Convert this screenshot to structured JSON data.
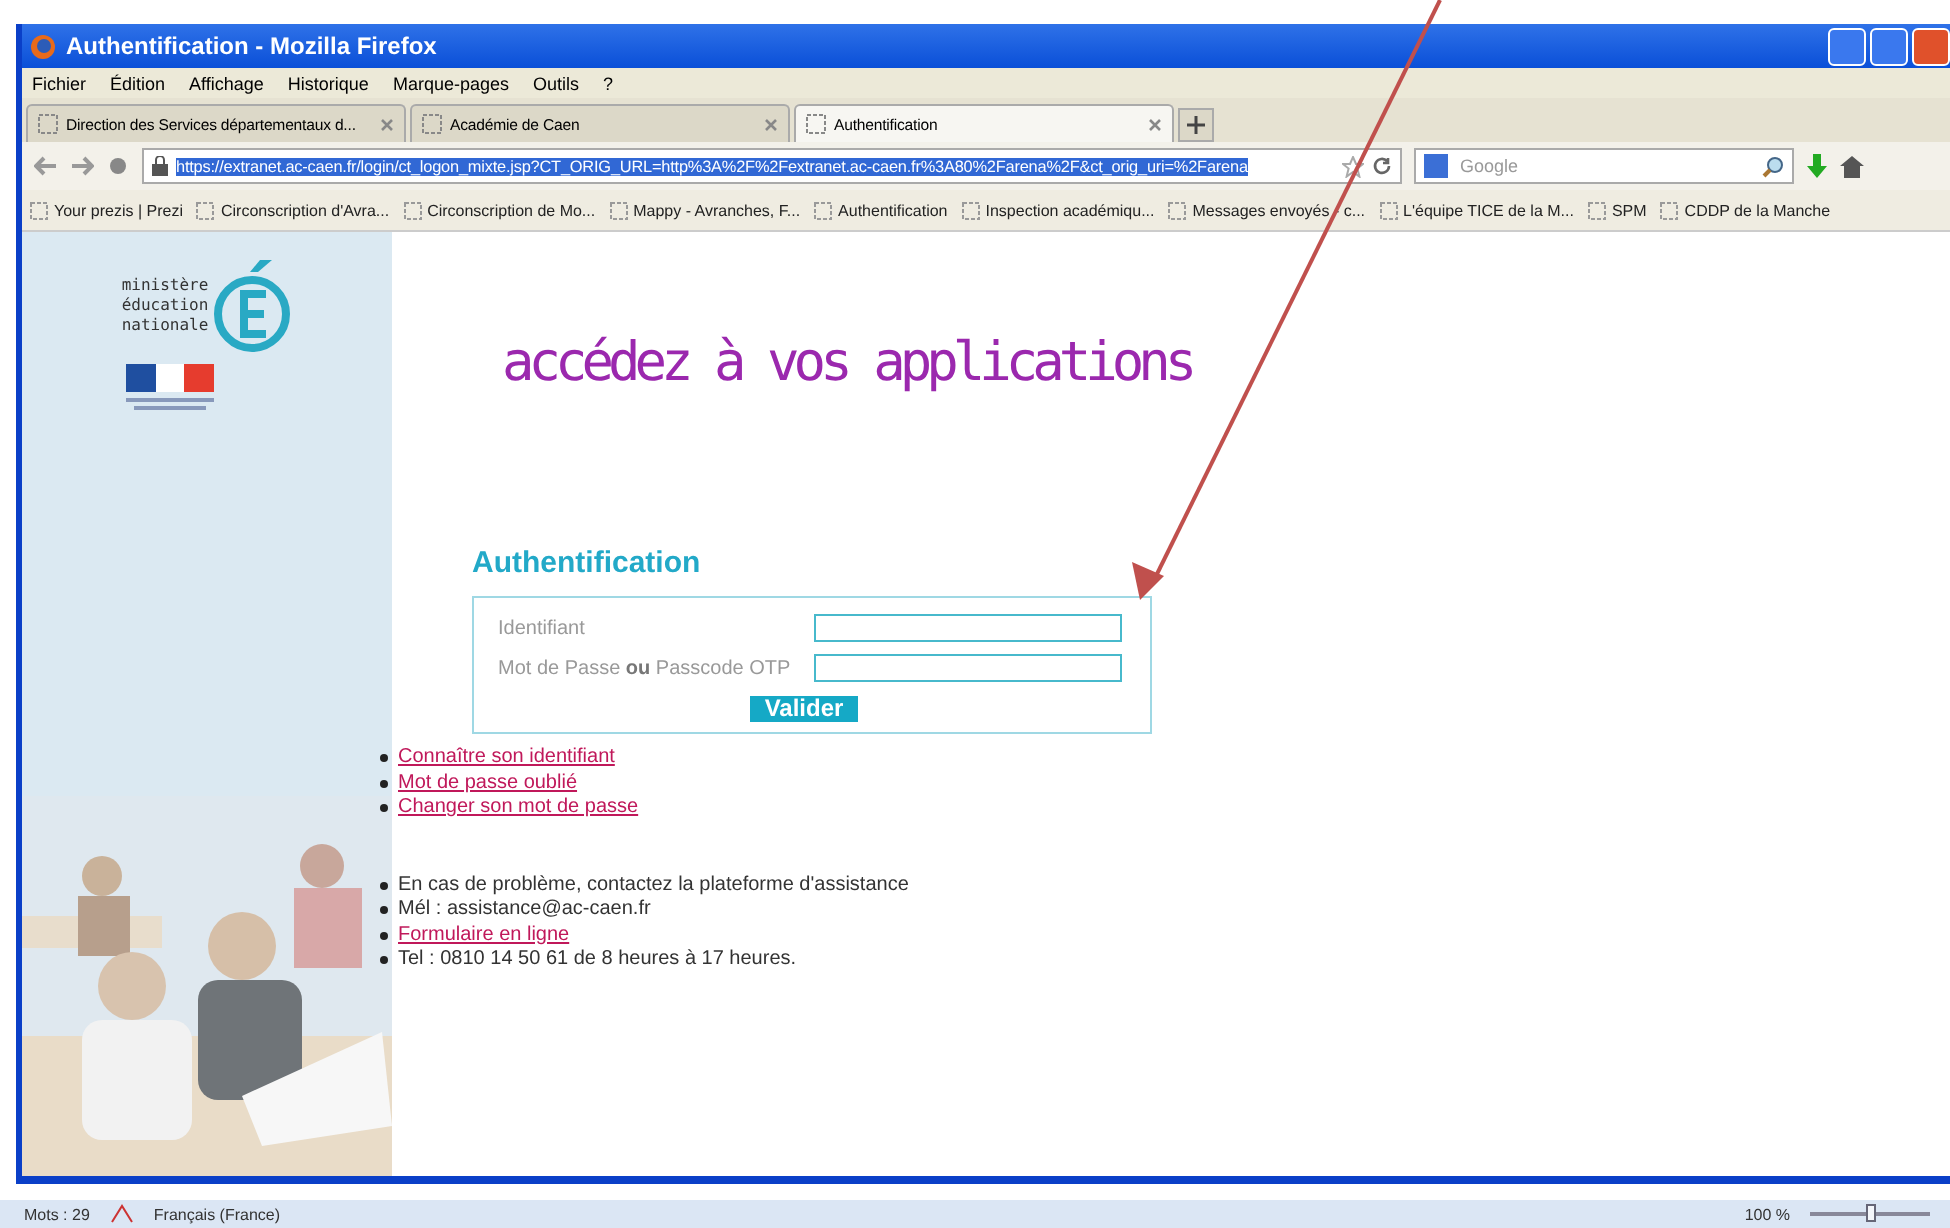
{
  "window": {
    "title": "Authentification - Mozilla Firefox"
  },
  "menu": [
    "Fichier",
    "Édition",
    "Affichage",
    "Historique",
    "Marque-pages",
    "Outils",
    "?"
  ],
  "tabs": [
    {
      "label": "Direction des Services départementaux d...",
      "selected": false
    },
    {
      "label": "Académie de Caen",
      "selected": false
    },
    {
      "label": "Authentification",
      "selected": true
    }
  ],
  "address": {
    "url": "https://extranet.ac-caen.fr/login/ct_logon_mixte.jsp?CT_ORIG_URL=http%3A%2F%2Fextranet.ac-caen.fr%3A80%2Farena%2F&ct_orig_uri=%2Farena"
  },
  "search": {
    "placeholder": "Google"
  },
  "bookmarks": [
    "Your prezis | Prezi",
    "Circonscription d'Avra...",
    "Circonscription de Mo...",
    "Mappy - Avranches, F...",
    "Authentification",
    "Inspection académiqu...",
    "Messages envoyés - c...",
    "L'équipe TICE de la M...",
    "SPM",
    "CDDP de la Manche"
  ],
  "page": {
    "logo_lines": [
      "ministère",
      "éducation",
      "nationale"
    ],
    "headline": "accédez à vos applications",
    "form_title": "Authentification",
    "fields": [
      {
        "label": "Identifiant"
      },
      {
        "label": "Mot de Passe **ou** Passcode OTP"
      }
    ],
    "submit": "Valider",
    "links": [
      "Connaître son identifiant",
      "Mot de passe oublié",
      "Changer son mot de passe"
    ],
    "help": [
      {
        "kind": "text",
        "text": "En cas de problème, contactez la plateforme d'assistance"
      },
      {
        "kind": "text",
        "text": "Mél : assistance@ac-caen.fr"
      },
      {
        "kind": "link",
        "text": "Formulaire en ligne"
      },
      {
        "kind": "text",
        "text": "Tel : 0810 14 50 61 de 8 heures à 17 heures."
      }
    ]
  },
  "status_bar": {
    "words": "Mots : 29",
    "language": "Français (France)",
    "zoom": "100 %",
    "zoom_slider": {
      "level": 0.5
    }
  }
}
